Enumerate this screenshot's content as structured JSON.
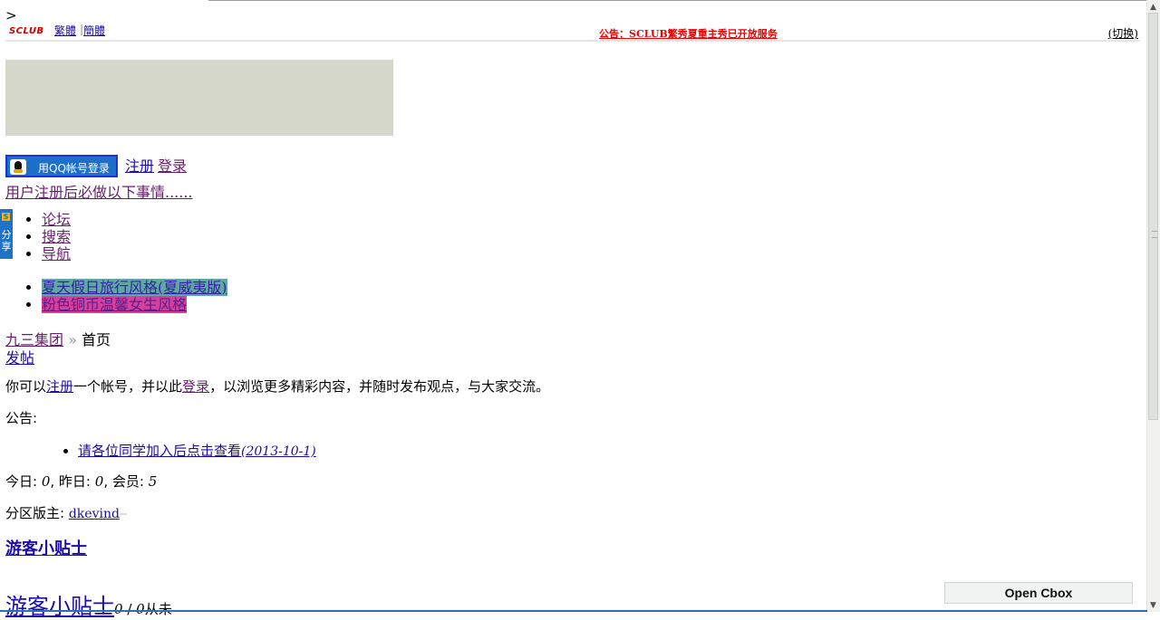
{
  "page": {
    "stray_char": ">"
  },
  "topbar": {
    "logo_text": "SCLUB",
    "lang_traditional": "繁體",
    "lang_simplified": "簡體",
    "notice": "公告：SCLUB繁秀夏重主秀已开放服务",
    "switch_label": "(切换)"
  },
  "auth": {
    "qq_login": "用QQ帐号登录",
    "register": "注册",
    "login": "登录",
    "must_do": "用户注册后必做以下事情......"
  },
  "share": {
    "icon_char": "S",
    "label_1": "分",
    "label_2": "享"
  },
  "nav": {
    "items": [
      "论坛",
      "搜索",
      "导航"
    ]
  },
  "styles": {
    "items": [
      "夏天假日旅行风格(夏威夷版)",
      "粉色铜币温馨女生风格"
    ]
  },
  "breadcrumb": {
    "home": "九三集团",
    "separator": "»",
    "current": "首页"
  },
  "actions": {
    "new_post": "发帖"
  },
  "intro": {
    "prefix": "你可以",
    "register": "注册",
    "mid": "一个帐号，并以此",
    "login": "登录",
    "suffix": "，以浏览更多精彩内容，并随时发布观点，与大家交流。"
  },
  "announcements": {
    "label": "公告:",
    "items": [
      {
        "title": "请各位同学加入后点击查看",
        "date": "(2013-10-1)"
      }
    ]
  },
  "stats": {
    "today_label": "今日:",
    "today": "0",
    "yesterday_label": ", 昨日:",
    "yesterday": "0",
    "members_label": ", 会员:",
    "members": "5"
  },
  "moderator": {
    "label": "分区版主:",
    "name": "dkevind"
  },
  "tips": {
    "heading_small": "游客小贴士",
    "heading_large": "游客小贴士",
    "count_a": "0",
    "count_sep": " / ",
    "count_b": "0",
    "count_suffix": "从未"
  },
  "cbox": {
    "label": "Open Cbox"
  },
  "colors": {
    "accent_blue": "#1d70c9",
    "link": "#1a0dab",
    "visited": "#681f6e",
    "notice_red": "#e00000",
    "style1_bg": "#5fa8a0",
    "style2_bg": "#d53f9d",
    "banner_bg": "#d4d7ca"
  }
}
